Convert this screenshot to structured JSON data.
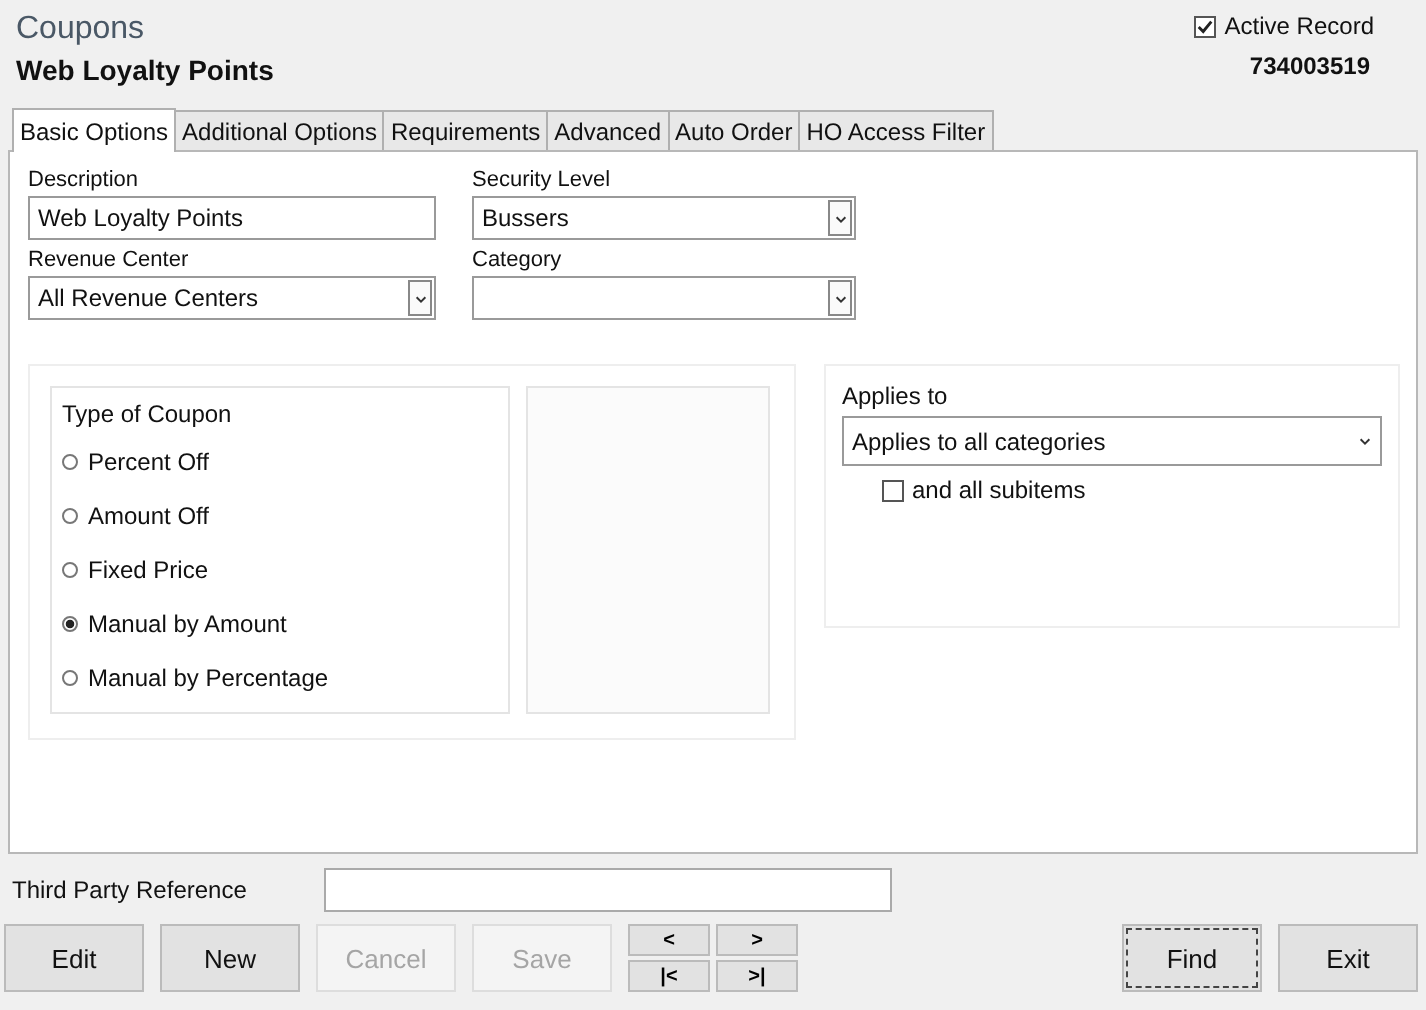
{
  "window": {
    "title": "Coupons",
    "subtitle": "Web Loyalty Points"
  },
  "active_record": {
    "label": "Active Record",
    "checked": true
  },
  "record_number": "734003519",
  "tabs": [
    {
      "label": "Basic Options",
      "selected": true
    },
    {
      "label": "Additional Options",
      "selected": false
    },
    {
      "label": "Requirements",
      "selected": false
    },
    {
      "label": "Advanced",
      "selected": false
    },
    {
      "label": "Auto Order",
      "selected": false
    },
    {
      "label": "HO Access Filter",
      "selected": false
    }
  ],
  "fields": [
    {
      "label": "Description",
      "kind": "text",
      "value": "Web Loyalty Points"
    },
    {
      "label": "Security Level",
      "kind": "dropdown",
      "value": "Bussers"
    },
    {
      "label": "Revenue Center",
      "kind": "dropdown",
      "value": "All Revenue Centers"
    },
    {
      "label": "Category",
      "kind": "dropdown"
    }
  ],
  "type_of_coupon": {
    "title": "Type of Coupon",
    "options": [
      {
        "label": "Percent Off",
        "selected": false
      },
      {
        "label": "Amount Off",
        "selected": false
      },
      {
        "label": "Fixed Price",
        "selected": false
      },
      {
        "label": "Manual by Amount",
        "selected": true
      },
      {
        "label": "Manual by Percentage",
        "selected": false
      }
    ]
  },
  "applies_to": {
    "label": "Applies to",
    "value": "Applies to all categories",
    "subitems": {
      "label": "and all subitems",
      "checked": false
    }
  },
  "third_party_reference": {
    "label": "Third Party Reference"
  },
  "buttons": [
    {
      "label": "Edit",
      "disabled": false,
      "focused": false
    },
    {
      "label": "New",
      "disabled": false,
      "focused": false
    },
    {
      "label": "Cancel",
      "disabled": true,
      "focused": false
    },
    {
      "label": "Save",
      "disabled": true,
      "focused": false
    }
  ],
  "nav_buttons": [
    "<",
    ">",
    "|<",
    ">|"
  ],
  "right_buttons": [
    {
      "label": "Find",
      "disabled": false,
      "focused": true
    },
    {
      "label": "Exit",
      "disabled": false,
      "focused": false
    }
  ]
}
